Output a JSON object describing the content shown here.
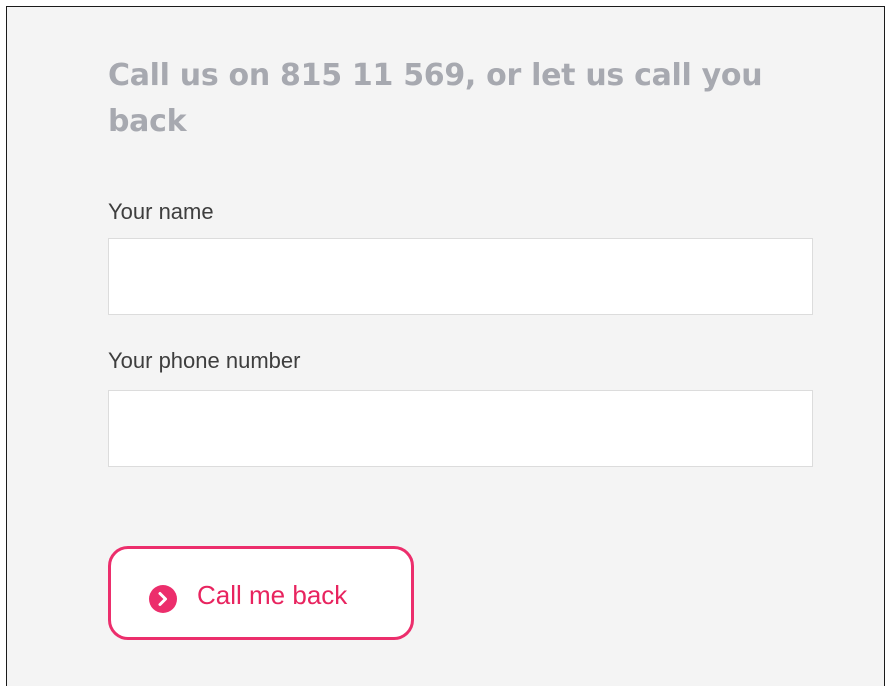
{
  "form": {
    "heading": "Call us on 815 11 569, or let us call you back",
    "name_label": "Your name",
    "name_value": "",
    "phone_label": "Your phone number",
    "phone_value": "",
    "submit_label": "Call me back",
    "submit_icon": "chevron-right-circle-icon"
  },
  "colors": {
    "heading": "#a7a9b0",
    "accent": "#ec2e6c",
    "panel_background": "#f4f4f4"
  }
}
